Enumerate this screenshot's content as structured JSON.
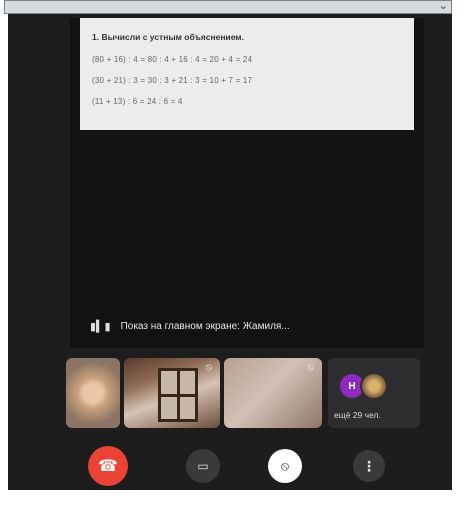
{
  "stage": {
    "task_title": "1. Вычисли с устным объяснением.",
    "lines": [
      "(80 + 16) : 4 = 80 : 4 + 16 : 4 = 20 + 4 = 24",
      "(30 + 21) : 3 = 30 : 3 + 21 : 3 = 10 + 7 = 17",
      "(11 + 13) : 6 = 24 : 6 = 4"
    ],
    "speaker_label": "Показ на главном экране: Жамиля..."
  },
  "tiles": {
    "avatar_initial": "Н",
    "more_label": "ещё 29 чел."
  },
  "icons": {
    "sound": "sound-wave-icon",
    "end_call": "end-call-icon",
    "camera": "camera-icon",
    "mic_off": "mic-off-icon",
    "more": "more-vert-icon"
  },
  "colors": {
    "end_call": "#ea4335",
    "avatar": "#8e2bbf",
    "background": "#1d1d1d"
  }
}
